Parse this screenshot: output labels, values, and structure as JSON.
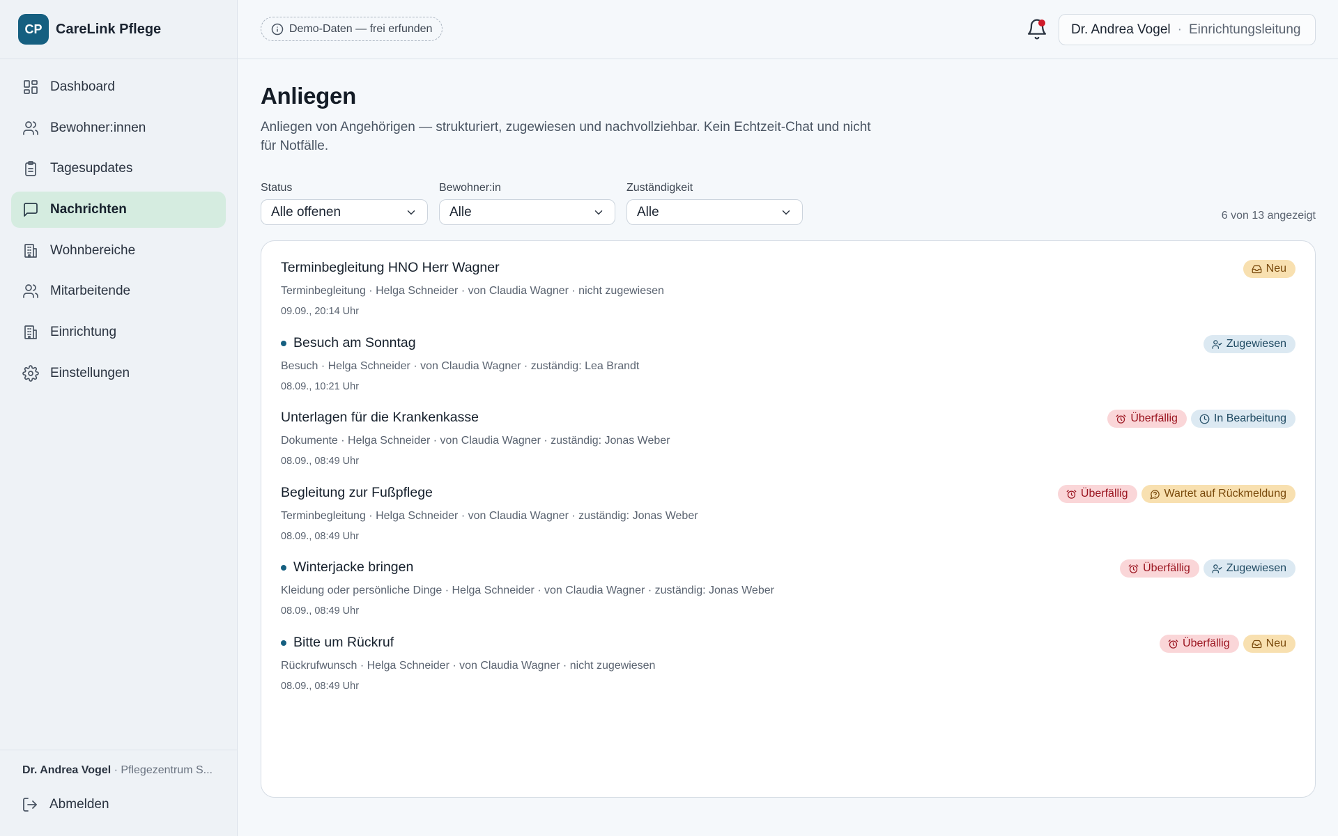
{
  "brand": {
    "logo": "CP",
    "name": "CareLink Pflege"
  },
  "nav": [
    {
      "label": "Dashboard",
      "icon": "dashboard-grid-icon"
    },
    {
      "label": "Bewohner:innen",
      "icon": "users-icon"
    },
    {
      "label": "Tagesupdates",
      "icon": "clipboard-icon"
    },
    {
      "label": "Nachrichten",
      "icon": "message-square-icon",
      "active": true
    },
    {
      "label": "Wohnbereiche",
      "icon": "building-icon"
    },
    {
      "label": "Mitarbeitende",
      "icon": "users-icon"
    },
    {
      "label": "Einrichtung",
      "icon": "building-icon"
    },
    {
      "label": "Einstellungen",
      "icon": "gear-icon"
    }
  ],
  "sidebar_footer": {
    "user_name": "Dr. Andrea Vogel",
    "facility": " · Pflegezentrum S...",
    "logout_label": "Abmelden"
  },
  "topbar": {
    "demo_badge": "Demo-Daten — frei erfunden",
    "user_name": "Dr. Andrea Vogel",
    "separator": "·",
    "user_role": "Einrichtungsleitung"
  },
  "page": {
    "title": "Anliegen",
    "subtitle": "Anliegen von Angehörigen — strukturiert, zugewiesen und nachvollziehbar. Kein Echtzeit-Chat und nicht für Notfälle."
  },
  "filters": {
    "status": {
      "label": "Status",
      "value": "Alle offenen"
    },
    "resident": {
      "label": "Bewohner:in",
      "value": "Alle"
    },
    "responsibility": {
      "label": "Zuständigkeit",
      "value": "Alle"
    },
    "count_text": "6 von 13 angezeigt"
  },
  "requests": [
    {
      "title": "Terminbegleitung HNO Herr Wagner",
      "unread": false,
      "meta": "Terminbegleitung · Helga Schneider · von Claudia Wagner · nicht zugewiesen",
      "time": "09.09., 20:14 Uhr",
      "badges": [
        {
          "type": "neu",
          "label": "Neu",
          "icon": "inbox-icon"
        }
      ]
    },
    {
      "title": "Besuch am Sonntag",
      "unread": true,
      "meta": "Besuch · Helga Schneider · von Claudia Wagner · zuständig: Lea Brandt",
      "time": "08.09., 10:21 Uhr",
      "badges": [
        {
          "type": "zugewiesen",
          "label": "Zugewiesen",
          "icon": "user-check-icon"
        }
      ]
    },
    {
      "title": "Unterlagen für die Krankenkasse",
      "unread": false,
      "meta": "Dokumente · Helga Schneider · von Claudia Wagner · zuständig: Jonas Weber",
      "time": "08.09., 08:49 Uhr",
      "badges": [
        {
          "type": "ueberfaellig",
          "label": "Überfällig",
          "icon": "alarm-clock-icon"
        },
        {
          "type": "bearbeitung",
          "label": "In Bearbeitung",
          "icon": "clock-icon"
        }
      ]
    },
    {
      "title": "Begleitung zur Fußpflege",
      "unread": false,
      "meta": "Terminbegleitung · Helga Schneider · von Claudia Wagner · zuständig: Jonas Weber",
      "time": "08.09., 08:49 Uhr",
      "badges": [
        {
          "type": "ueberfaellig",
          "label": "Überfällig",
          "icon": "alarm-clock-icon"
        },
        {
          "type": "wartet",
          "label": "Wartet auf Rückmeldung",
          "icon": "message-question-icon"
        }
      ]
    },
    {
      "title": "Winterjacke bringen",
      "unread": true,
      "meta": "Kleidung oder persönliche Dinge · Helga Schneider · von Claudia Wagner · zuständig: Jonas Weber",
      "time": "08.09., 08:49 Uhr",
      "badges": [
        {
          "type": "ueberfaellig",
          "label": "Überfällig",
          "icon": "alarm-clock-icon"
        },
        {
          "type": "zugewiesen",
          "label": "Zugewiesen",
          "icon": "user-check-icon"
        }
      ]
    },
    {
      "title": "Bitte um Rückruf",
      "unread": true,
      "meta": "Rückrufwunsch · Helga Schneider · von Claudia Wagner · nicht zugewiesen",
      "time": "08.09., 08:49 Uhr",
      "badges": [
        {
          "type": "ueberfaellig",
          "label": "Überfällig",
          "icon": "alarm-clock-icon"
        },
        {
          "type": "neu",
          "label": "Neu",
          "icon": "inbox-icon"
        }
      ]
    }
  ],
  "colors": {
    "brand": "#155f80",
    "nav_active_bg": "#d5ece0",
    "overdue_bg": "#fad6d8",
    "new_bg": "#f8e0b0",
    "assigned_bg": "#dce9f2",
    "notification_dot": "#d01c2b"
  }
}
